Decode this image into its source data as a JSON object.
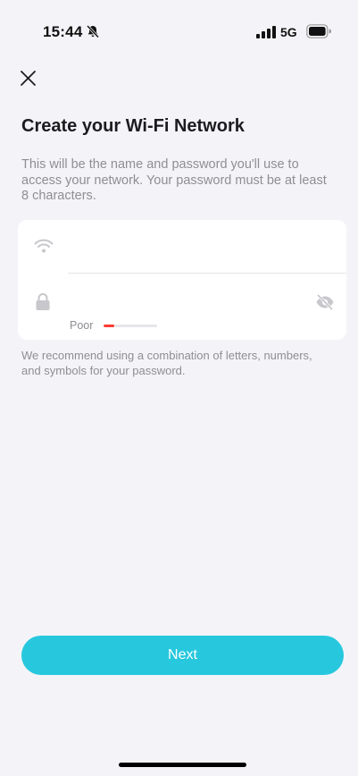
{
  "status_bar": {
    "time": "15:44",
    "network_type": "5G",
    "icons": [
      "bell-off-icon",
      "signal-icon",
      "battery-icon"
    ]
  },
  "header": {
    "close_icon": "close-icon"
  },
  "title": "Create your Wi-Fi Network",
  "description": "This will be the name and password you'll use to access your network. Your password must be at least 8 characters.",
  "form": {
    "ssid": {
      "value": "",
      "placeholder": "",
      "icon": "wifi-icon"
    },
    "password": {
      "value": "",
      "placeholder": "",
      "icon": "lock-icon",
      "visibility_icon": "eye-off-icon"
    },
    "strength": {
      "label": "Poor",
      "level": 0.2,
      "color": "#ff3b30"
    }
  },
  "hint": "We recommend using a combination of letters, numbers, and symbols for your password.",
  "actions": {
    "next_label": "Next"
  },
  "colors": {
    "accent": "#27c8de",
    "background": "#f4f4f8",
    "strength_poor": "#ff3b30"
  }
}
